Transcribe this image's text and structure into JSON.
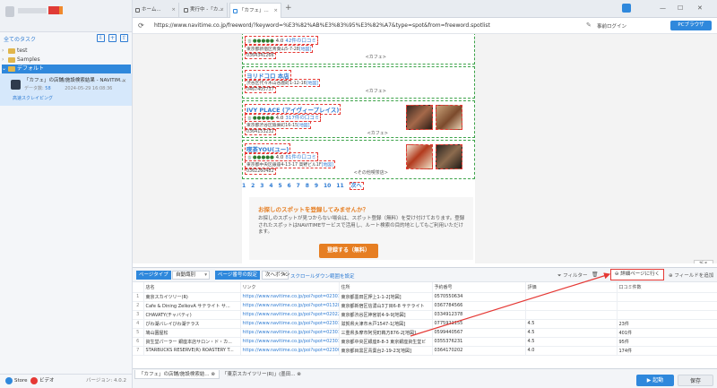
{
  "sidebar": {
    "tasks_title": "全てのタスク",
    "tree": [
      {
        "label": "test"
      },
      {
        "label": "Samples"
      },
      {
        "label": "デフォルト"
      }
    ],
    "task": {
      "name": "「カフェ」の店舗/施設検索結果 - NAVITIM...",
      "count_label": "データ数:",
      "count": "58",
      "date": "2024-05-29 16:08:36",
      "status": "高速スクレイピング"
    },
    "bottom": {
      "store": "Store",
      "video": "ビデオ",
      "version": "バージョン: 4.0.2"
    }
  },
  "browser": {
    "tabs": [
      {
        "label": "ホーム..."
      },
      {
        "label": "実行中 -「カ..."
      },
      {
        "label": "「カフェ」..."
      }
    ],
    "url": "https://www.navitime.co.jp/freeword/?keyword=%E3%82%AB%E3%83%95%E3%82%A7&type=spot&from=freeword.spotlist",
    "login": "事前ログイン",
    "browser_btn": "PCブラウザ"
  },
  "page": {
    "spots": [
      {
        "name": "",
        "rating": "4.0",
        "reviews": "42件の口コミ",
        "address": "東京都新宿区青葉山5-7-28",
        "map": "[地図]",
        "tel": "0364341266",
        "category": "<カフェ>"
      },
      {
        "name": "ヨリドコロ 本店",
        "rating": "",
        "reviews": "",
        "address": "渋谷区代々木山谷鹿町1-12-16",
        "map": "[地図]",
        "tel": "0467405737",
        "category": "<カフェ>"
      },
      {
        "name": "IVY PLACE (アイヴィープレイス)",
        "rating": "4.0",
        "reviews": "317件の口コミ",
        "address": "東京都渋谷区猿楽町16-15",
        "map": "[地図]",
        "tel": "0364153232",
        "category": "<カフェ>"
      },
      {
        "name": "喫茶YOU(ユー)",
        "rating": "4.0",
        "reviews": "81件の口コミ",
        "address": "東京都中央区銀座4-13-17 高野ビル1F",
        "map": "[地図]",
        "tel": "0362260482",
        "category": "<その他喫茶店>"
      }
    ],
    "pages": [
      "1",
      "2",
      "3",
      "4",
      "5",
      "6",
      "7",
      "8",
      "9",
      "10",
      "11"
    ],
    "next": "次へ",
    "register": {
      "title": "お探しのスポットを登録してみませんか？",
      "desc": "お探しのスポットが見つからない場合は、スポット登録（無料）を受け付けております。登録されたスポットはNAVITIMEサービスで活用し、ルート検索の目的地としてもご利用いただけます。",
      "button": "登録する（無料）"
    },
    "collapse": "折る"
  },
  "datapanel": {
    "page_type_label": "ページタイプ",
    "page_type_value": "自動識別",
    "page_setting_label": "ページ番号の設定",
    "page_setting_value": "次へボタン",
    "scroll_link": "スクロールダウン範囲を設定",
    "filter": "フィルター",
    "detail_button": "詳細ページに行く",
    "add_field": "フィールドを追加",
    "columns": [
      "",
      "店名",
      "リンク",
      "住所",
      "予約番号",
      "評価",
      "口コミ件数"
    ],
    "rows": [
      [
        "1",
        "東京スカイツリー(R)",
        "https://www.navitime.co.jp/poi?spot=02301...",
        "東京都墨田区押上1-1-2[地図]",
        "0570550634",
        "",
        ""
      ],
      [
        "2",
        "Cafe & Dining ZelkovA サテライト サ...",
        "https://www.navitime.co.jp/poi?spot=01328...",
        "東京都新宿区信濃山3丁目6-8 サテライト",
        "0367784566",
        "",
        ""
      ],
      [
        "3",
        "CHAVATY(チャバティ)",
        "https://www.navitime.co.jp/poi?spot=02022...",
        "東京都渋谷区神宮前4-9-9[地図]",
        "0334912378",
        "",
        ""
      ],
      [
        "4",
        "ぴわ湖バレイびわ湖テラス",
        "https://www.navitime.co.jp/poi?spot=02301...",
        "滋賀県大津市木戸1547-1[地図]",
        "0775921155",
        "4.5",
        "23件"
      ],
      [
        "5",
        "鳩山園屋松",
        "https://www.navitime.co.jp/poi?spot=02301...",
        "三重県多摩市阿児町鵜方876-2[地図]",
        "0599440567",
        "4.5",
        "401件"
      ],
      [
        "6",
        "資生堂パーラー 銀座本店サロン・ド・カ...",
        "https://www.navitime.co.jp/poi?spot=02301...",
        "東京都中央区銀座8-8-3 東京銀座資生堂ビ",
        "0355376231",
        "4.5",
        "95件"
      ],
      [
        "7",
        "STARBUCKS RESERVE(R) ROASTERY T...",
        "https://www.navitime.co.jp/poi?spot=02300...",
        "東京都目黒区青葉台2-19-23[地図]",
        "0364170202",
        "4.0",
        "174件"
      ]
    ]
  },
  "statusbar": {
    "tabs": [
      {
        "label": "「カフェ」の店舗/施設検索結..."
      },
      {
        "label": "「東京スカイツリー(R)」(墨田..."
      }
    ],
    "start": "起動",
    "save": "保存"
  },
  "colors": {
    "accent": "#2f88dc",
    "orange": "#e67e22",
    "highlight": "#e53935",
    "select_green": "#3da34a"
  }
}
